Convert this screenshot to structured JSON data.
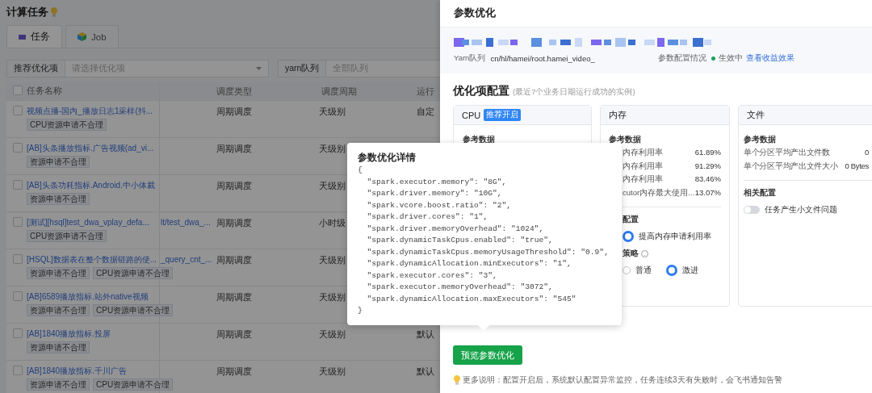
{
  "page": {
    "title": "计算任务",
    "tabs": [
      {
        "label": "任务",
        "kind": "task",
        "selected": true
      },
      {
        "label": "Job",
        "kind": "job",
        "selected": false
      }
    ],
    "filters": [
      {
        "label": "推荐优化项",
        "placeholder": "请选择优化项",
        "kind": "select"
      },
      {
        "label": "yarn队列",
        "placeholder": "全部队列",
        "kind": "input"
      }
    ],
    "table": {
      "header_checked": false,
      "columns": {
        "name": "任务名称",
        "column_3": "调度类型",
        "column_4": "调度周期",
        "column_5": "运行"
      },
      "rows": [
        {
          "checked": false,
          "name": "视频点播-国内_播放日志1采样(抖...",
          "tags": [
            "CPU资源申请不合理"
          ],
          "column_3": "周期调度",
          "column_4": "天级别",
          "column_5": "自定"
        },
        {
          "checked": false,
          "name": "[AB]头条播放指标.广告视频(ad_vi...",
          "tags": [
            "资源申请不合理"
          ],
          "column_3": "周期调度",
          "column_4": "天级别"
        },
        {
          "checked": false,
          "name": "[AB]头条功耗指标.Android.中小体裁",
          "tags": [
            "资源申请不合理"
          ],
          "column_3": "周期调度",
          "column_4": "天级别"
        },
        {
          "checked": false,
          "name": "[测试][hsql]test_dwa_vplay_defa...",
          "column_2": "lt/test_dwa_...",
          "tags": [
            "CPU资源申请不合理"
          ],
          "column_3": "周期调度",
          "column_4": "小时级"
        },
        {
          "checked": false,
          "name": "[HSQL]数据表在整个数据链路的使...",
          "column_2": "_query_cnt_...",
          "tags": [
            "资源申请不合理",
            "CPU资源申请不合理"
          ],
          "column_3": "周期调度",
          "column_4": "天级别"
        },
        {
          "checked": false,
          "name": "[AB]6589播放指标.站外native视频",
          "tags": [
            "资源申请不合理",
            "CPU资源申请不合理"
          ],
          "column_3": "周期调度",
          "column_4": "天级别"
        },
        {
          "checked": false,
          "name": "[AB]1840播放指标.投屏",
          "tags": [
            "资源申请不合理"
          ],
          "column_3": "周期调度",
          "column_4": "天级别",
          "column_5": "默认"
        },
        {
          "checked": false,
          "name": "[AB]1840播放指标.千川广告",
          "tags": [
            "资源申请不合理",
            "CPU资源申请不合理"
          ],
          "column_3": "周期调度",
          "column_4": "天级别",
          "column_5": "默认"
        }
      ]
    }
  },
  "drawer": {
    "title": "参数优化",
    "yarn_label": "Yarn队列",
    "yarn_value": "cn/hl/hamei/root.hamei_video_",
    "status_label": "参数配置情况",
    "status": "生效中",
    "status_link": "查看收益效果",
    "section_title": "优化项配置",
    "section_subtitle": "(最近7个业务日期运行成功的实例)",
    "cards": [
      {
        "kind": "cpu",
        "title": "CPU",
        "badge": "推荐开启",
        "ref_title": "参考数据"
      },
      {
        "kind": "memory",
        "title": "内存",
        "ref_title": "参考数据",
        "metrics": [
          {
            "label": "内存利用率",
            "value": "61.89%"
          },
          {
            "label": "内存利用率",
            "value": "91.29%"
          },
          {
            "label": "内存利用率",
            "value": "83.46%"
          },
          {
            "label": "cutor内存最大使用...",
            "value": "13.07%"
          }
        ],
        "config_title": "配置",
        "config_option": {
          "label": "提高内存申请利用率",
          "checked": true
        },
        "strategy_title": "策略",
        "strategy_options": [
          {
            "label": "普通",
            "selected": false
          },
          {
            "label": "激进",
            "selected": true
          }
        ]
      },
      {
        "kind": "file",
        "title": "文件",
        "ref_title": "参考数据",
        "metrics": [
          {
            "label": "单个分区平均产出文件数",
            "value": "0"
          },
          {
            "label": "单个分区平均产出文件大小",
            "value": "0 Bytes"
          }
        ],
        "related_title": "相关配置",
        "toggle": {
          "label": "任务产生小文件问题",
          "on": false
        }
      }
    ],
    "button": "预览参数优化",
    "note": "更多说明：配置开启后，系统默认配置异常监控，任务连续3天有失败时，会飞书通知告警"
  },
  "popover": {
    "title": "参数优化详情",
    "lines": [
      "{",
      "  \"spark.executor.memory\": \"8G\",",
      "  \"spark.driver.memory\": \"10G\",",
      "  \"spark.vcore.boost.ratio\": \"2\",",
      "  \"spark.driver.cores\": \"1\",",
      "  \"spark.driver.memoryOverhead\": \"1024\",",
      "  \"spark.dynamicTaskCpus.enabled\": \"true\",",
      "  \"spark.dynamicTaskCpus.memoryUsageThreshold\": \"0.9\",",
      "  \"spark.dynamicAllocation.minExecutors\": \"1\",",
      "  \"spark.executor.cores\": \"3\",",
      "  \"spark.executor.memoryOverhead\": \"3072\",",
      "  \"spark.dynamicAllocation.maxExecutors\": \"545\"",
      "}"
    ]
  }
}
